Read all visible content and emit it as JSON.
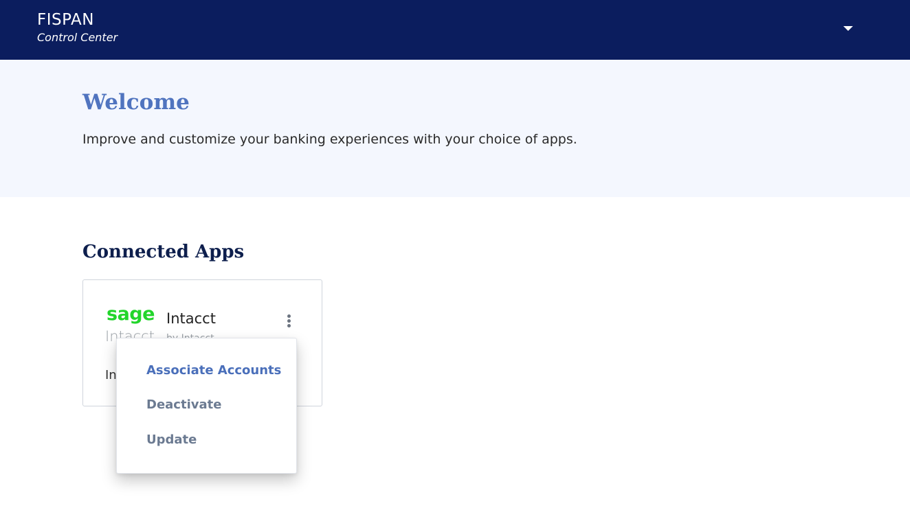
{
  "header": {
    "brand_name": "FISPAN",
    "brand_subtitle": "Control Center",
    "dropdown_icon": "caret-down-icon",
    "background_color": "#0b1d5e"
  },
  "welcome": {
    "title": "Welcome",
    "description": "Improve and customize your banking experiences with your choice of apps.",
    "title_color": "#5074bf",
    "background_color": "#f4f7fe"
  },
  "connected_apps": {
    "title": "Connected Apps",
    "apps": [
      {
        "logo_wordmark": "sage",
        "logo_product": "Intacct",
        "name": "Intacct",
        "vendor": "by Intacct",
        "status": "In",
        "logo_color": "#22d52b",
        "menu_icon": "kebab-icon"
      }
    ]
  },
  "action_menu": {
    "items": [
      {
        "label": "Associate Accounts"
      },
      {
        "label": "Deactivate"
      },
      {
        "label": "Update"
      }
    ]
  }
}
